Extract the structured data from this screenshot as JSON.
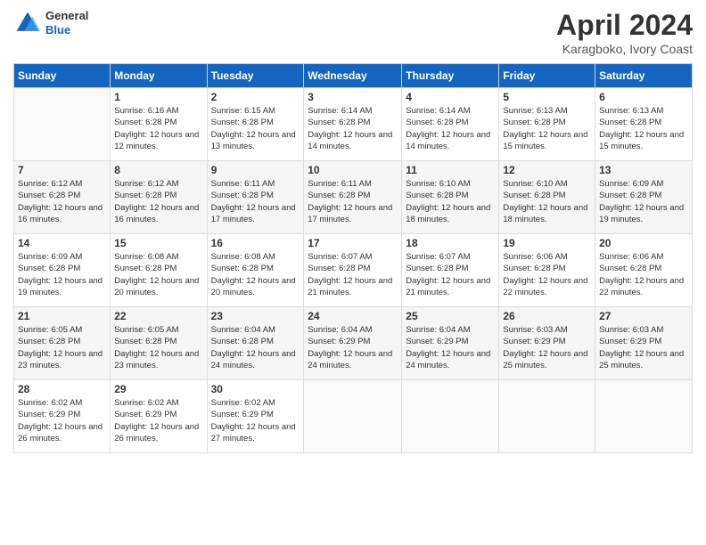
{
  "header": {
    "logo_general": "General",
    "logo_blue": "Blue",
    "main_title": "April 2024",
    "subtitle": "Karagboko, Ivory Coast"
  },
  "calendar": {
    "days": [
      "Sunday",
      "Monday",
      "Tuesday",
      "Wednesday",
      "Thursday",
      "Friday",
      "Saturday"
    ],
    "weeks": [
      [
        {
          "num": "",
          "sunrise": "",
          "sunset": "",
          "daylight": ""
        },
        {
          "num": "1",
          "sunrise": "Sunrise: 6:16 AM",
          "sunset": "Sunset: 6:28 PM",
          "daylight": "Daylight: 12 hours and 12 minutes."
        },
        {
          "num": "2",
          "sunrise": "Sunrise: 6:15 AM",
          "sunset": "Sunset: 6:28 PM",
          "daylight": "Daylight: 12 hours and 13 minutes."
        },
        {
          "num": "3",
          "sunrise": "Sunrise: 6:14 AM",
          "sunset": "Sunset: 6:28 PM",
          "daylight": "Daylight: 12 hours and 14 minutes."
        },
        {
          "num": "4",
          "sunrise": "Sunrise: 6:14 AM",
          "sunset": "Sunset: 6:28 PM",
          "daylight": "Daylight: 12 hours and 14 minutes."
        },
        {
          "num": "5",
          "sunrise": "Sunrise: 6:13 AM",
          "sunset": "Sunset: 6:28 PM",
          "daylight": "Daylight: 12 hours and 15 minutes."
        },
        {
          "num": "6",
          "sunrise": "Sunrise: 6:13 AM",
          "sunset": "Sunset: 6:28 PM",
          "daylight": "Daylight: 12 hours and 15 minutes."
        }
      ],
      [
        {
          "num": "7",
          "sunrise": "Sunrise: 6:12 AM",
          "sunset": "Sunset: 6:28 PM",
          "daylight": "Daylight: 12 hours and 16 minutes."
        },
        {
          "num": "8",
          "sunrise": "Sunrise: 6:12 AM",
          "sunset": "Sunset: 6:28 PM",
          "daylight": "Daylight: 12 hours and 16 minutes."
        },
        {
          "num": "9",
          "sunrise": "Sunrise: 6:11 AM",
          "sunset": "Sunset: 6:28 PM",
          "daylight": "Daylight: 12 hours and 17 minutes."
        },
        {
          "num": "10",
          "sunrise": "Sunrise: 6:11 AM",
          "sunset": "Sunset: 6:28 PM",
          "daylight": "Daylight: 12 hours and 17 minutes."
        },
        {
          "num": "11",
          "sunrise": "Sunrise: 6:10 AM",
          "sunset": "Sunset: 6:28 PM",
          "daylight": "Daylight: 12 hours and 18 minutes."
        },
        {
          "num": "12",
          "sunrise": "Sunrise: 6:10 AM",
          "sunset": "Sunset: 6:28 PM",
          "daylight": "Daylight: 12 hours and 18 minutes."
        },
        {
          "num": "13",
          "sunrise": "Sunrise: 6:09 AM",
          "sunset": "Sunset: 6:28 PM",
          "daylight": "Daylight: 12 hours and 19 minutes."
        }
      ],
      [
        {
          "num": "14",
          "sunrise": "Sunrise: 6:09 AM",
          "sunset": "Sunset: 6:28 PM",
          "daylight": "Daylight: 12 hours and 19 minutes."
        },
        {
          "num": "15",
          "sunrise": "Sunrise: 6:08 AM",
          "sunset": "Sunset: 6:28 PM",
          "daylight": "Daylight: 12 hours and 20 minutes."
        },
        {
          "num": "16",
          "sunrise": "Sunrise: 6:08 AM",
          "sunset": "Sunset: 6:28 PM",
          "daylight": "Daylight: 12 hours and 20 minutes."
        },
        {
          "num": "17",
          "sunrise": "Sunrise: 6:07 AM",
          "sunset": "Sunset: 6:28 PM",
          "daylight": "Daylight: 12 hours and 21 minutes."
        },
        {
          "num": "18",
          "sunrise": "Sunrise: 6:07 AM",
          "sunset": "Sunset: 6:28 PM",
          "daylight": "Daylight: 12 hours and 21 minutes."
        },
        {
          "num": "19",
          "sunrise": "Sunrise: 6:06 AM",
          "sunset": "Sunset: 6:28 PM",
          "daylight": "Daylight: 12 hours and 22 minutes."
        },
        {
          "num": "20",
          "sunrise": "Sunrise: 6:06 AM",
          "sunset": "Sunset: 6:28 PM",
          "daylight": "Daylight: 12 hours and 22 minutes."
        }
      ],
      [
        {
          "num": "21",
          "sunrise": "Sunrise: 6:05 AM",
          "sunset": "Sunset: 6:28 PM",
          "daylight": "Daylight: 12 hours and 23 minutes."
        },
        {
          "num": "22",
          "sunrise": "Sunrise: 6:05 AM",
          "sunset": "Sunset: 6:28 PM",
          "daylight": "Daylight: 12 hours and 23 minutes."
        },
        {
          "num": "23",
          "sunrise": "Sunrise: 6:04 AM",
          "sunset": "Sunset: 6:28 PM",
          "daylight": "Daylight: 12 hours and 24 minutes."
        },
        {
          "num": "24",
          "sunrise": "Sunrise: 6:04 AM",
          "sunset": "Sunset: 6:29 PM",
          "daylight": "Daylight: 12 hours and 24 minutes."
        },
        {
          "num": "25",
          "sunrise": "Sunrise: 6:04 AM",
          "sunset": "Sunset: 6:29 PM",
          "daylight": "Daylight: 12 hours and 24 minutes."
        },
        {
          "num": "26",
          "sunrise": "Sunrise: 6:03 AM",
          "sunset": "Sunset: 6:29 PM",
          "daylight": "Daylight: 12 hours and 25 minutes."
        },
        {
          "num": "27",
          "sunrise": "Sunrise: 6:03 AM",
          "sunset": "Sunset: 6:29 PM",
          "daylight": "Daylight: 12 hours and 25 minutes."
        }
      ],
      [
        {
          "num": "28",
          "sunrise": "Sunrise: 6:02 AM",
          "sunset": "Sunset: 6:29 PM",
          "daylight": "Daylight: 12 hours and 26 minutes."
        },
        {
          "num": "29",
          "sunrise": "Sunrise: 6:02 AM",
          "sunset": "Sunset: 6:29 PM",
          "daylight": "Daylight: 12 hours and 26 minutes."
        },
        {
          "num": "30",
          "sunrise": "Sunrise: 6:02 AM",
          "sunset": "Sunset: 6:29 PM",
          "daylight": "Daylight: 12 hours and 27 minutes."
        },
        {
          "num": "",
          "sunrise": "",
          "sunset": "",
          "daylight": ""
        },
        {
          "num": "",
          "sunrise": "",
          "sunset": "",
          "daylight": ""
        },
        {
          "num": "",
          "sunrise": "",
          "sunset": "",
          "daylight": ""
        },
        {
          "num": "",
          "sunrise": "",
          "sunset": "",
          "daylight": ""
        }
      ]
    ]
  }
}
